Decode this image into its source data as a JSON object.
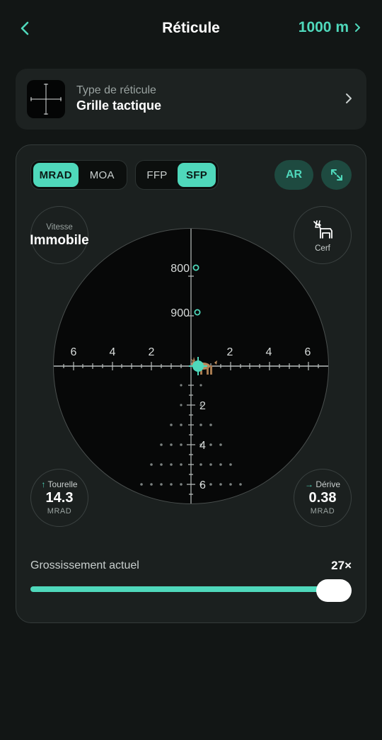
{
  "header": {
    "title": "Réticule",
    "distance": "1000 m"
  },
  "reticle_type": {
    "label": "Type de réticule",
    "value": "Grille tactique"
  },
  "units": {
    "options": [
      "MRAD",
      "MOA"
    ],
    "selected": "MRAD"
  },
  "focal_plane": {
    "options": [
      "FFP",
      "SFP"
    ],
    "selected": "SFP"
  },
  "ar_label": "AR",
  "speed": {
    "label": "Vitesse",
    "value": "Immobile"
  },
  "game": {
    "label": "Cerf",
    "icon": "deer-icon"
  },
  "turret": {
    "label": "Tourelle",
    "value": "14.3",
    "unit": "MRAD"
  },
  "drift": {
    "label": "Dérive",
    "value": "0.38",
    "unit": "MRAD"
  },
  "reticle": {
    "horizontal_labels": [
      "6",
      "4",
      "2",
      "2",
      "4",
      "6"
    ],
    "vertical_labels": [
      "2",
      "4",
      "6"
    ],
    "range_markers": [
      "800",
      "900"
    ]
  },
  "zoom": {
    "label": "Grossissement actuel",
    "value": "27×",
    "level": 1.0
  },
  "colors": {
    "accent": "#4fd8bb",
    "background": "#121615",
    "card": "#1d2221"
  }
}
